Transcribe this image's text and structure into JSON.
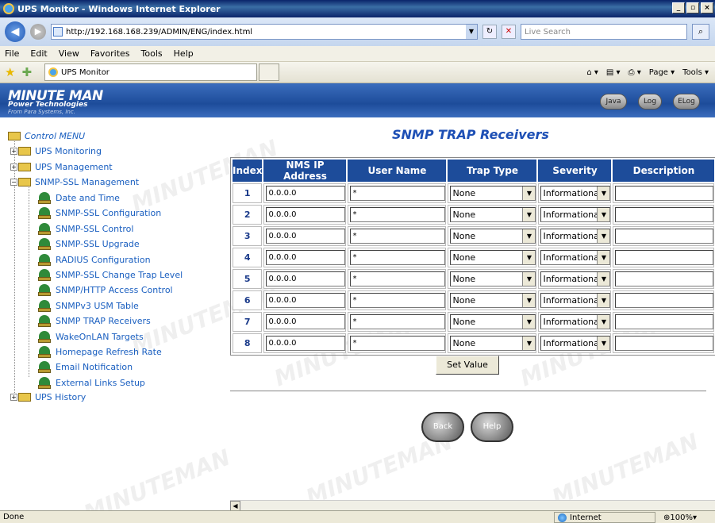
{
  "window": {
    "title": "UPS Monitor - Windows Internet Explorer"
  },
  "address": {
    "url": "http://192.168.168.239/ADMIN/ENG/index.html",
    "search_placeholder": "Live Search"
  },
  "menubar": [
    "File",
    "Edit",
    "View",
    "Favorites",
    "Tools",
    "Help"
  ],
  "tab": {
    "label": "UPS Monitor"
  },
  "commandbar": {
    "page": "Page",
    "tools": "Tools"
  },
  "banner": {
    "logo": "MINUTE MAN",
    "logo_sub": "Power Technologies",
    "logo_sub2": "From Para Systems, Inc.",
    "buttons": [
      "Java",
      "Log",
      "ELog"
    ]
  },
  "leftmenu": {
    "root": "Control MENU",
    "groups": [
      "UPS Monitoring",
      "UPS Management",
      "SNMP-SSL Management",
      "UPS History"
    ],
    "items": [
      "Date and Time",
      "SNMP-SSL Configuration",
      "SNMP-SSL Control",
      "SNMP-SSL Upgrade",
      "RADIUS Configuration",
      "SNMP-SSL Change Trap Level",
      "SNMP/HTTP Access Control",
      "SNMPv3 USM Table",
      "SNMP TRAP Receivers",
      "WakeOnLAN Targets",
      "Homepage Refresh Rate",
      "Email Notification",
      "External Links Setup"
    ]
  },
  "main": {
    "title": "SNMP TRAP Receivers",
    "columns": [
      "Index",
      "NMS IP Address",
      "User Name",
      "Trap Type",
      "Severity",
      "Description"
    ],
    "rows": [
      {
        "index": "1",
        "ip": "0.0.0.0",
        "user": "*",
        "trap": "None",
        "severity": "Informational",
        "desc": ""
      },
      {
        "index": "2",
        "ip": "0.0.0.0",
        "user": "*",
        "trap": "None",
        "severity": "Informational",
        "desc": ""
      },
      {
        "index": "3",
        "ip": "0.0.0.0",
        "user": "*",
        "trap": "None",
        "severity": "Informational",
        "desc": ""
      },
      {
        "index": "4",
        "ip": "0.0.0.0",
        "user": "*",
        "trap": "None",
        "severity": "Informational",
        "desc": ""
      },
      {
        "index": "5",
        "ip": "0.0.0.0",
        "user": "*",
        "trap": "None",
        "severity": "Informational",
        "desc": ""
      },
      {
        "index": "6",
        "ip": "0.0.0.0",
        "user": "*",
        "trap": "None",
        "severity": "Informational",
        "desc": ""
      },
      {
        "index": "7",
        "ip": "0.0.0.0",
        "user": "*",
        "trap": "None",
        "severity": "Informational",
        "desc": ""
      },
      {
        "index": "8",
        "ip": "0.0.0.0",
        "user": "*",
        "trap": "None",
        "severity": "Informational",
        "desc": ""
      }
    ],
    "set_value": "Set Value",
    "back": "Back",
    "help": "Help",
    "watermark": "MINUTEMAN"
  },
  "status": {
    "left": "Done",
    "zone": "Internet",
    "zoom": "100%"
  }
}
